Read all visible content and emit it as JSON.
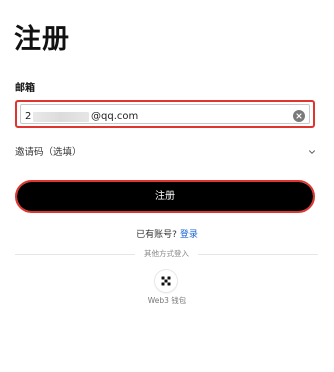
{
  "page": {
    "title": "注册"
  },
  "email": {
    "label": "邮箱",
    "value_first_char": "2",
    "value_domain": "@qq.com"
  },
  "invite": {
    "label": "邀请码（选填）"
  },
  "register": {
    "button_label": "注册"
  },
  "login": {
    "prompt": "已有账号?",
    "link_label": "登录"
  },
  "other_methods": {
    "divider_text": "其他方式登入",
    "web3_label": "Web3 钱包",
    "web3_icon": "wallet-icon"
  },
  "colors": {
    "accent_red": "#e0342e",
    "primary_button": "#000000",
    "link_blue": "#1a63d6"
  }
}
